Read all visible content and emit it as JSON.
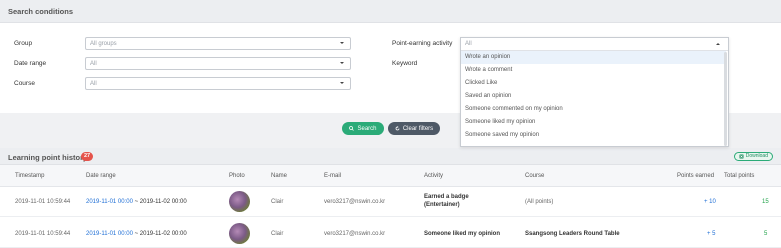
{
  "search": {
    "title": "Search conditions",
    "group": {
      "label": "Group",
      "value": "All groups"
    },
    "date_range": {
      "label": "Date range",
      "value": "All"
    },
    "course": {
      "label": "Course",
      "value": "All"
    },
    "activity": {
      "label": "Point-earning activity",
      "value": "All"
    },
    "keyword": {
      "label": "Keyword"
    },
    "search_button": "Search",
    "clear_button": "Clear filters"
  },
  "dropdown": {
    "options": [
      "Wrote an opinion",
      "Wrote a comment",
      "Clicked Like",
      "Saved an opinion",
      "Someone commented on my opinion",
      "Someone liked my opinion",
      "Someone saved my opinion"
    ],
    "highlighted_index": 0
  },
  "history": {
    "title": "Learning point history",
    "count": "27",
    "download_label": "Download",
    "columns": [
      "Timestamp",
      "Date range",
      "Photo",
      "Name",
      "E-mail",
      "Activity",
      "Course",
      "Points earned",
      "Total points"
    ],
    "rows": [
      {
        "timestamp": "2019-11-01 10:59:44",
        "date_start": "2019-11-01 00:00",
        "sep": "~",
        "date_end": "2019-11-02 00:00",
        "name": "Clair",
        "email": "vero3217@nswin.co.kr",
        "activity_line1": "Earned a badge",
        "activity_line2": "(Entertainer)",
        "course": "(All points)",
        "points": "+ 10",
        "total": "15"
      },
      {
        "timestamp": "2019-11-01 10:59:44",
        "date_start": "2019-11-01 00:00",
        "sep": "~",
        "date_end": "2019-11-02 00:00",
        "name": "Clair",
        "email": "vero3217@nswin.co.kr",
        "activity_line1": "Someone liked my opinion",
        "course": "Ssangsong Leaders Round Table",
        "points": "+ 5",
        "total": "5"
      }
    ]
  },
  "colors": {
    "accent_green": "#2bab78",
    "dark_button": "#4e5966",
    "link_blue": "#1f6fd6",
    "badge_red": "#e5534b"
  },
  "icons": [
    "chevron-down-icon",
    "chevron-up-icon",
    "search-icon",
    "refresh-icon",
    "excel-icon"
  ]
}
